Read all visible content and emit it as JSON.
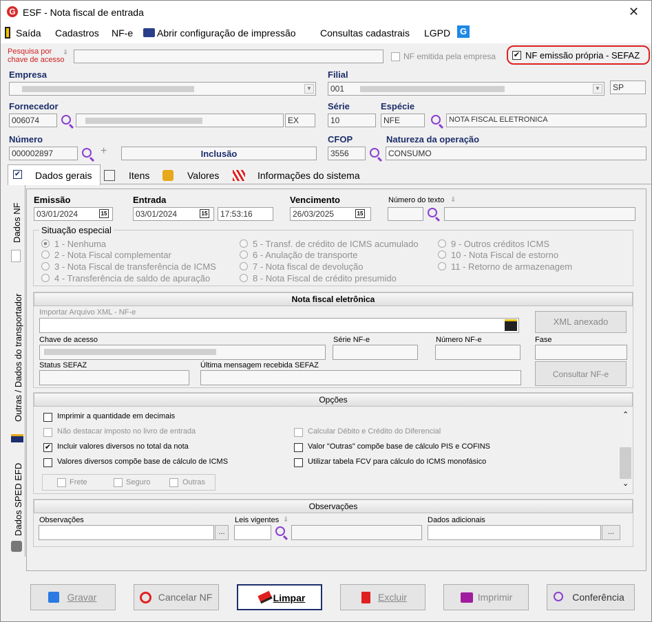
{
  "window": {
    "title": "ESF - Nota fiscal de entrada",
    "close": "✕"
  },
  "menu": [
    "Saída",
    "Cadastros",
    "NF-e",
    "Abrir configuração de impressão",
    "Consultas cadastrais",
    "LGPD"
  ],
  "search": {
    "label_line1": "Pesquisa por",
    "label_line2": "chave de acesso",
    "value": ""
  },
  "checks_top": {
    "nf_emitida": "NF emitida pela empresa",
    "nf_propria": "NF emissão própria - SEFAZ"
  },
  "empresa": {
    "label": "Empresa"
  },
  "filial": {
    "label": "Filial",
    "code": "001",
    "uf": "SP"
  },
  "fornecedor": {
    "label": "Fornecedor",
    "code": "006074",
    "suffix": "EX"
  },
  "serie": {
    "label": "Série",
    "value": "10"
  },
  "especie": {
    "label": "Espécie",
    "code": "NFE",
    "desc": "NOTA FISCAL ELETRONICA"
  },
  "numero": {
    "label": "Número",
    "value": "000002897",
    "mode": "Inclusão"
  },
  "cfop": {
    "label": "CFOP",
    "value": "3556"
  },
  "natureza": {
    "label": "Natureza da operação",
    "value": "CONSUMO"
  },
  "tabs": [
    "Dados gerais",
    "Itens",
    "Valores",
    "Informações do sistema"
  ],
  "vtabs": [
    "Dados NF",
    "Outras / Dados do transportador",
    "Dados SPED EFD"
  ],
  "dates": {
    "emissao_label": "Emissão",
    "emissao": "03/01/2024",
    "entrada_label": "Entrada",
    "entrada": "03/01/2024",
    "hora": "17:53:16",
    "venc_label": "Vencimento",
    "vencimento": "26/03/2025",
    "numtexto_label": "Número do texto",
    "cal_icon": "15"
  },
  "situacao": {
    "label": "Situação especial",
    "options": [
      "1 - Nenhuma",
      "2 - Nota Fiscal complementar",
      "3 - Nota Fiscal de transferência de ICMS",
      "4 - Transferência de saldo de apuração",
      "5 - Transf. de crédito de ICMS acumulado",
      "6 - Anulação de transporte",
      "7 - Nota fiscal de devolução",
      "8 - Nota Fiscal de crédito presumido",
      "9 - Outros créditos ICMS",
      "10 - Nota Fiscal de estorno",
      "11 - Retorno de armazenagem"
    ]
  },
  "nfe": {
    "title": "Nota fiscal eletrônica",
    "import_label": "Importar Arquivo XML - NF-e",
    "xml_btn": "XML anexado",
    "chave_label": "Chave de acesso",
    "serie_label": "Série NF-e",
    "numero_label": "Número NF-e",
    "fase_label": "Fase",
    "status_label": "Status SEFAZ",
    "ultima_label": "Última mensagem recebida SEFAZ",
    "consultar_btn": "Consultar NF-e"
  },
  "opcoes": {
    "title": "Opções",
    "items": [
      "Imprimir a quantidade em decimais",
      "Não destacar imposto no livro de entrada",
      "Incluir valores diversos no total da nota",
      "Valores diversos compõe base de cálculo de ICMS",
      "Calcular Débito e Crédito do Diferencial",
      "Valor \"Outras\" compõe base de cálculo PIS e COFINS",
      "Utilizar tabela FCV para cálculo do ICMS monofásico"
    ],
    "sub": [
      "Frete",
      "Seguro",
      "Outras"
    ],
    "check": "✔"
  },
  "observacoes": {
    "title": "Observações",
    "obs_label": "Observações",
    "leis_label": "Leis vigentes",
    "dados_label": "Dados adicionais",
    "ellipsis": "..."
  },
  "buttons": [
    "Gravar",
    "Cancelar NF",
    "Limpar",
    "Excluir",
    "Imprimir",
    "Conferência"
  ],
  "colors": {
    "accent": "#1c2e6b",
    "highlight": "#e02020",
    "magnifier": "#8a3fd1"
  }
}
